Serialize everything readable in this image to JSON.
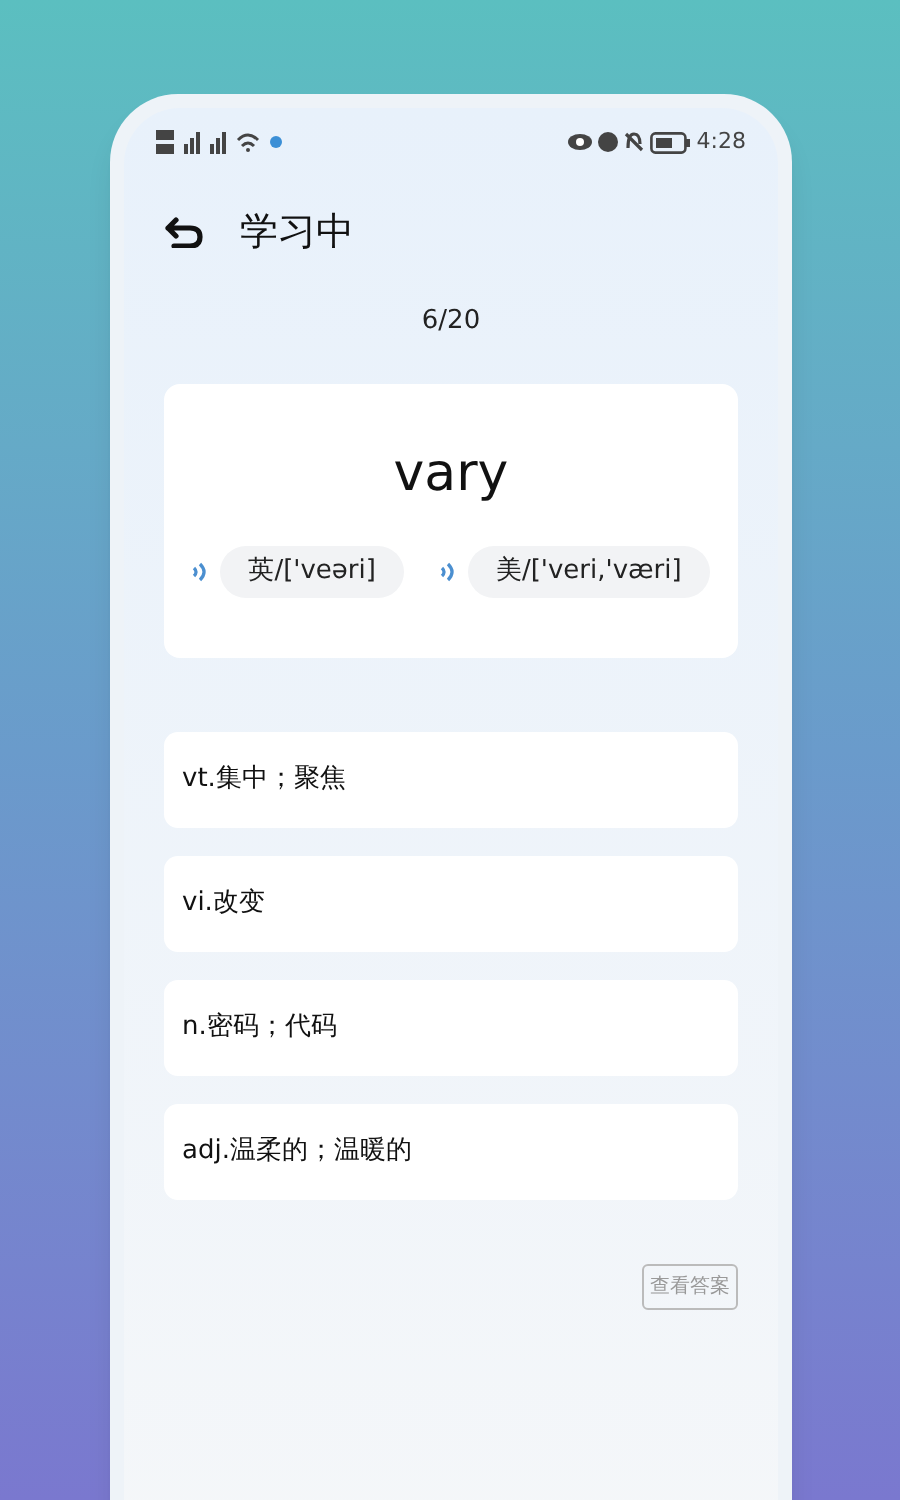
{
  "status_bar": {
    "time": "4:28"
  },
  "header": {
    "title": "学习中"
  },
  "progress": "6/20",
  "word": {
    "text": "vary",
    "pronunciations": [
      {
        "label": "英/['veəri]"
      },
      {
        "label": "美/['veri,'væri]"
      }
    ]
  },
  "options": [
    {
      "text": "vt.集中；聚焦"
    },
    {
      "text": "vi.改变"
    },
    {
      "text": "n.密码；代码"
    },
    {
      "text": "adj.温柔的；温暖的"
    }
  ],
  "answer_button": "查看答案"
}
